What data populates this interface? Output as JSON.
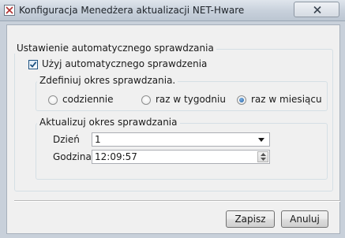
{
  "window": {
    "title": "Konfiguracja Menedżera aktualizacji NET-Hware",
    "close_label": "✕"
  },
  "auto_check": {
    "group_label": "Ustawienie automatycznego sprawdzania",
    "checkbox_label": "Użyj automatycznego sprawdzenia",
    "checked": true
  },
  "period": {
    "group_label": "Zdefiniuj okres sprawdzania.",
    "options": [
      "codziennie",
      "raz w tygodniu",
      "raz w miesiącu"
    ],
    "selected": "raz w miesiącu"
  },
  "schedule": {
    "group_label": "Aktualizuj okres sprawdzania",
    "day_label": "Dzień",
    "day_value": "1",
    "hour_label": "Godzina",
    "hour_value": "12:09:57"
  },
  "buttons": {
    "save": "Zapisz",
    "cancel": "Anuluj"
  },
  "colors": {
    "titlebar": "#c7d0db",
    "client_bg": "#f0f0f0",
    "checkmark": "#1c5180",
    "radio_selected": "#1f5fa3"
  }
}
